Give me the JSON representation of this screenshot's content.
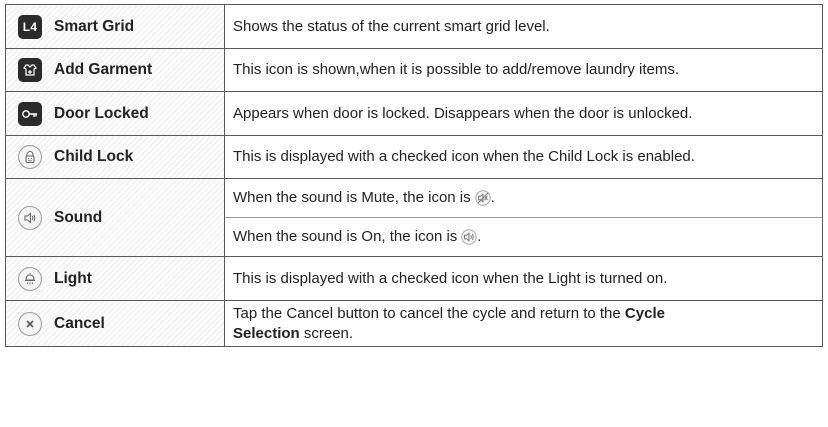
{
  "rows": [
    {
      "label": "Smart Grid",
      "icon": "l4-icon",
      "badge_text": "L4",
      "description": "Shows the status of the current smart grid level."
    },
    {
      "label": "Add Garment",
      "icon": "add-garment-icon",
      "description": "This icon is shown,when it is possible to add/remove laundry items."
    },
    {
      "label": "Door Locked",
      "icon": "key-icon",
      "description": "Appears when door is locked. Disappears when the door is unlocked."
    },
    {
      "label": "Child Lock",
      "icon": "child-lock-icon",
      "description": "This is displayed with a checked icon when the Child Lock is enabled."
    },
    {
      "label": "Sound",
      "icon": "speaker-icon",
      "description_line1": "When the sound is Mute, the icon is",
      "description_line2": "When the sound is On, the icon is",
      "line_end": "."
    },
    {
      "label": "Light",
      "icon": "light-icon",
      "description": "This is displayed with a checked icon when the Light is turned on."
    },
    {
      "label": "Cancel",
      "icon": "cancel-icon",
      "description_pre": "Tap the Cancel button to cancel the cycle and return to the ",
      "description_bold1": "Cycle",
      "description_bold2": "Selection",
      "description_post": " screen."
    }
  ],
  "colors": {
    "border": "#5a5a5a",
    "icon_dark": "#2b2b2b",
    "text": "#222222"
  }
}
